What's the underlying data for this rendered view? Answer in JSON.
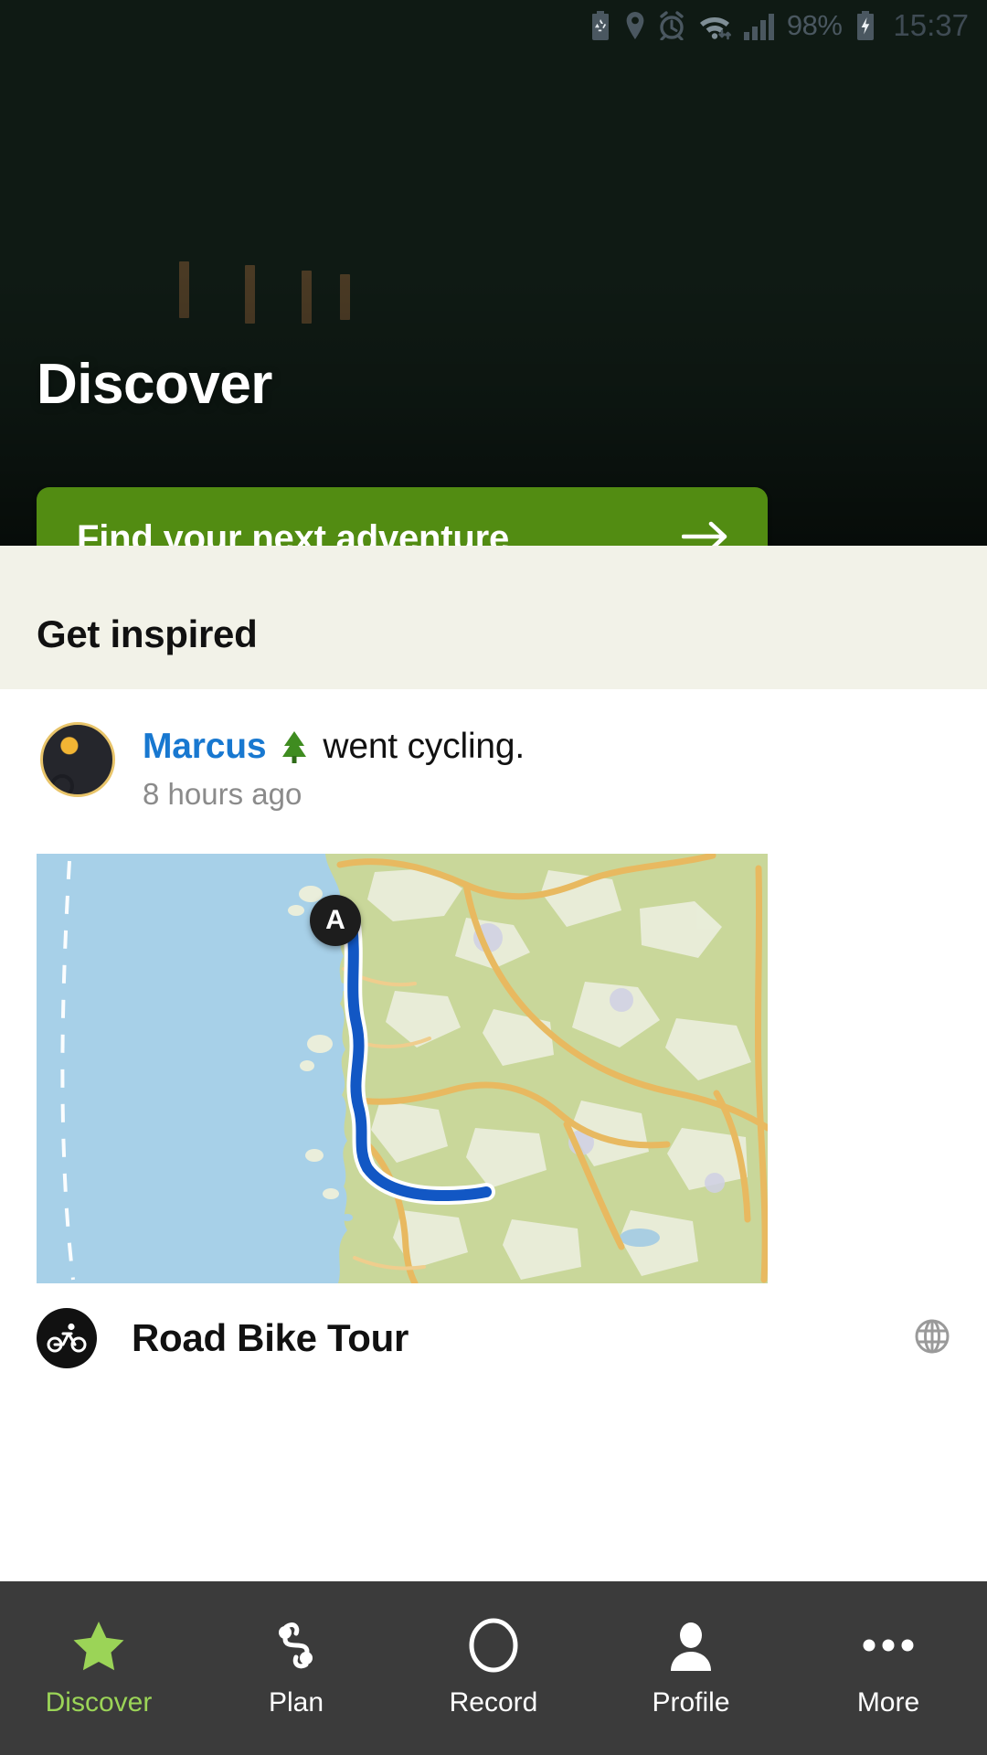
{
  "statusbar": {
    "icons": [
      "battery-saver-icon",
      "location-icon",
      "alarm-icon",
      "wifi-icon",
      "signal-icon"
    ],
    "battery_percent": "98%",
    "battery_icon": "battery-charging-icon",
    "time": "15:37"
  },
  "hero": {
    "title": "Discover",
    "cta_label": "Find your next adventure",
    "cta_icon": "arrow-right-icon",
    "cta_color": "#528c12"
  },
  "sections": {
    "inspired_title": "Get inspired"
  },
  "feed": {
    "post": {
      "avatar_name": "marcus-avatar",
      "username": "Marcus",
      "badge_icon": "tree-icon",
      "action_text": "went cycling.",
      "timestamp": "8 hours ago",
      "username_color": "#1878d0",
      "map": {
        "marker_label": "A",
        "route_color": "#1257c4",
        "water_color": "#a7d0e8",
        "land_color": "#c9d79a",
        "road_color": "#e8b960"
      },
      "tour_title": "Road Bike Tour",
      "tour_icon": "cyclist-icon",
      "visibility_icon": "globe-icon"
    }
  },
  "bottomnav": {
    "items": [
      {
        "label": "Discover",
        "icon": "star-icon",
        "active": true
      },
      {
        "label": "Plan",
        "icon": "route-icon",
        "active": false
      },
      {
        "label": "Record",
        "icon": "record-circle-icon",
        "active": false
      },
      {
        "label": "Profile",
        "icon": "person-icon",
        "active": false
      },
      {
        "label": "More",
        "icon": "ellipsis-icon",
        "active": false
      }
    ],
    "active_color": "#9bd457",
    "background": "#3b3b3b"
  }
}
